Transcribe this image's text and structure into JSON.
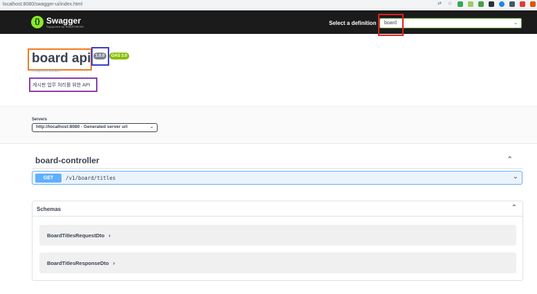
{
  "browser": {
    "url": "localhost:8080/swagger-ui/index.html"
  },
  "topbar": {
    "logo_name": "Swagger",
    "logo_sub": "Supported by SMARTBEAR",
    "definition_label": "Select a definition",
    "definition_value": "board"
  },
  "info": {
    "title": "board api",
    "version": "1.0.0",
    "oas": "OAS 3.0",
    "api_url": "/v3/api-docs/board",
    "description": "게시판 업무 처리를 위한 API"
  },
  "servers": {
    "label": "Servers",
    "selected": "http://localhost:8080 - Generated server url"
  },
  "controller": {
    "name": "board-controller",
    "operations": [
      {
        "method": "GET",
        "path": "/v1/board/titles"
      }
    ]
  },
  "schemas": {
    "title": "Schemas",
    "models": [
      {
        "name": "BoardTitlesRequestDto"
      },
      {
        "name": "BoardTitlesResponseDto"
      }
    ]
  },
  "colors": {
    "topbar_bg": "#1b1b1b",
    "get_method": "#61affe",
    "oas_badge": "#89bf04",
    "version_badge": "#7d8492",
    "highlight_red": "#e02020",
    "highlight_orange": "#f07a1e",
    "highlight_blue": "#3a3ad0",
    "highlight_purple": "#8b3bb0"
  },
  "icons": {
    "translate": "translate-icon",
    "bookmark": "star-icon",
    "chevron": "chevron-icon"
  }
}
